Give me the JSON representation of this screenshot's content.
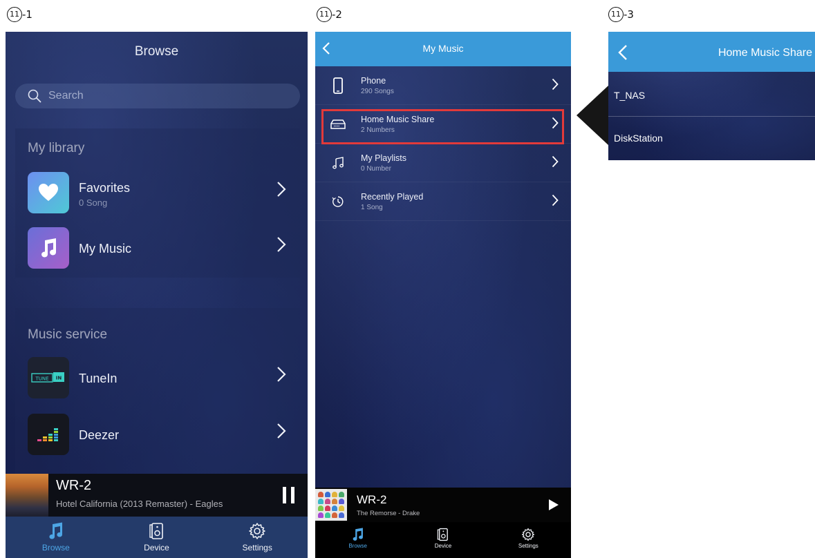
{
  "captions": {
    "c1": {
      "num": "11",
      "suffix": "-1"
    },
    "c2": {
      "num": "11",
      "suffix": "-2"
    },
    "c3": {
      "num": "11",
      "suffix": "-3"
    }
  },
  "screen1": {
    "title": "Browse",
    "search_placeholder": "Search",
    "library_title": "My library",
    "library_items": [
      {
        "label": "Favorites",
        "sub": "0 Song",
        "icon": "heart-icon"
      },
      {
        "label": "My Music",
        "sub": "",
        "icon": "music-note-icon"
      }
    ],
    "service_title": "Music service",
    "service_items": [
      {
        "label": "TuneIn",
        "logo_text_a": "TUNE",
        "logo_text_b": "IN",
        "icon": "tunein-logo"
      },
      {
        "label": "Deezer",
        "icon": "deezer-logo"
      }
    ],
    "now_playing": {
      "device": "WR-2",
      "track": "Hotel California (2013 Remaster) - Eagles",
      "state": "pause"
    },
    "tabs": [
      {
        "label": "Browse",
        "icon": "music-note-icon",
        "active": true
      },
      {
        "label": "Device",
        "icon": "speaker-icon",
        "active": false
      },
      {
        "label": "Settings",
        "icon": "gear-icon",
        "active": false
      }
    ],
    "colors": {
      "tab_active": "#4da6e6",
      "tabbar": "#243b6a"
    }
  },
  "screen2": {
    "title": "My Music",
    "items": [
      {
        "label": "Phone",
        "sub": "290 Songs",
        "icon": "phone-icon"
      },
      {
        "label": "Home Music Share",
        "sub": "2 Numbers",
        "icon": "nas-drive-icon",
        "highlighted": true
      },
      {
        "label": "My Playlists",
        "sub": "0 Number",
        "icon": "music-notes-icon"
      },
      {
        "label": "Recently Played",
        "sub": "1 Song",
        "icon": "clock-icon"
      }
    ],
    "now_playing": {
      "device": "WR-2",
      "track": "The Remorse - Drake",
      "state": "play"
    },
    "tabs": [
      {
        "label": "Browse",
        "icon": "music-note-icon",
        "active": true
      },
      {
        "label": "Device",
        "icon": "speaker-icon",
        "active": false
      },
      {
        "label": "Settings",
        "icon": "gear-icon",
        "active": false
      }
    ],
    "colors": {
      "header": "#3a9ad9",
      "highlight": "#e23a3a"
    }
  },
  "screen3": {
    "title": "Home Music Share",
    "items": [
      {
        "label": "T_NAS"
      },
      {
        "label": "DiskStation"
      }
    ],
    "colors": {
      "header": "#3a9ad9"
    }
  }
}
